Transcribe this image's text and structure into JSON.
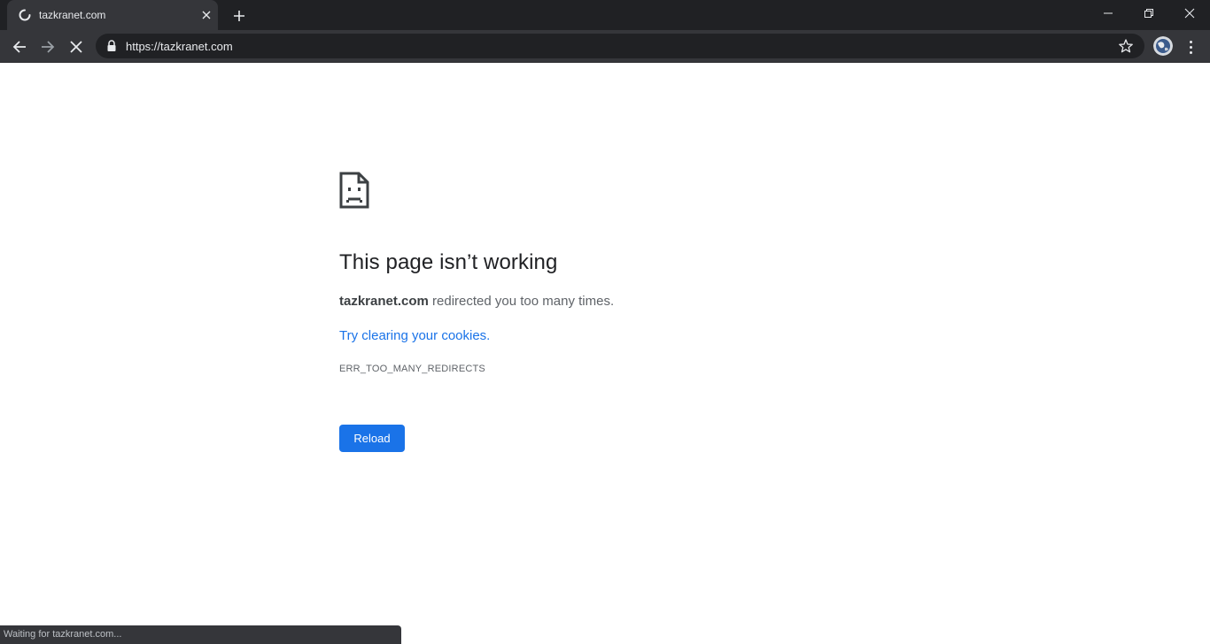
{
  "tab": {
    "title": "tazkranet.com"
  },
  "toolbar": {
    "url": "https://tazkranet.com"
  },
  "error": {
    "title": "This page isn’t working",
    "domain": "tazkranet.com",
    "message": " redirected you too many times.",
    "link_text": "Try clearing your cookies.",
    "code": "ERR_TOO_MANY_REDIRECTS",
    "reload_label": "Reload"
  },
  "status": {
    "text": "Waiting for tazkranet.com..."
  },
  "colors": {
    "accent": "#1a73e8",
    "chrome_dark": "#202124",
    "chrome_toolbar": "#35363a"
  },
  "icons": [
    "loading-spinner-icon",
    "close-icon",
    "plus-icon",
    "minimize-icon",
    "restore-icon",
    "window-close-icon",
    "back-arrow-icon",
    "forward-arrow-icon",
    "stop-icon",
    "lock-icon",
    "star-icon",
    "profile-avatar-icon",
    "menu-dots-icon",
    "sad-page-icon"
  ]
}
